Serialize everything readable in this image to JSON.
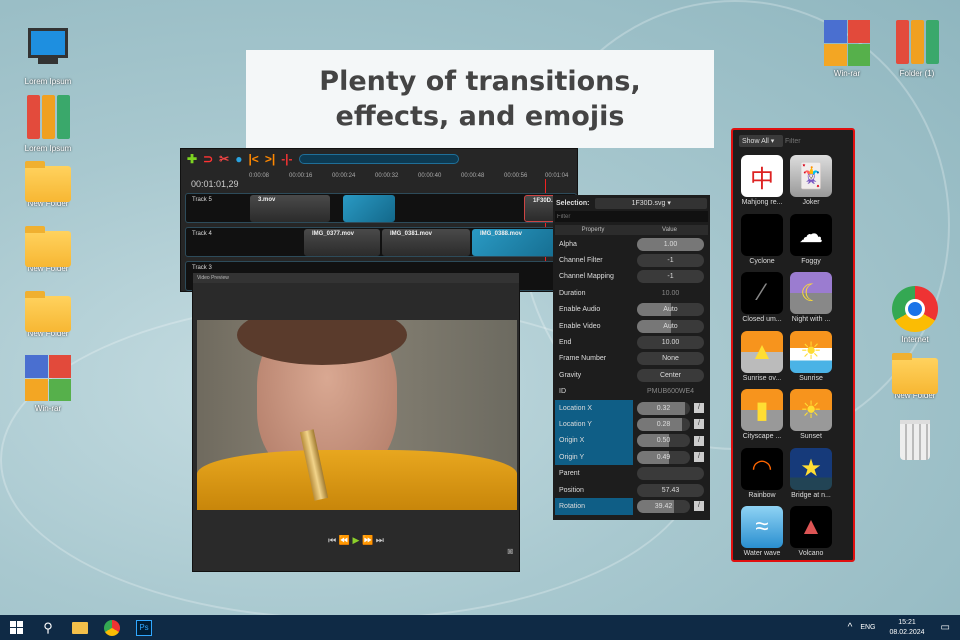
{
  "banner": {
    "line1": "Plenty of transitions,",
    "line2": "effects, and emojis"
  },
  "desktop_left": [
    {
      "label": "Lorem Ipsum",
      "icon": "computer-icon"
    },
    {
      "label": "Lorem Ipsum",
      "icon": "binders-icon"
    },
    {
      "label": "New Folder",
      "icon": "folder-icon"
    },
    {
      "label": "New Folder",
      "icon": "folder-icon"
    },
    {
      "label": "New Folder",
      "icon": "folder-icon"
    },
    {
      "label": "Win-rar",
      "icon": "winrar-icon"
    }
  ],
  "desktop_top_right": [
    {
      "label": "Win-rar",
      "icon": "winrar-icon"
    },
    {
      "label": "Folder (1)",
      "icon": "binders-icon"
    }
  ],
  "desktop_right": [
    {
      "label": "Internet",
      "icon": "chrome-icon"
    },
    {
      "label": "New Folder",
      "icon": "folder-icon"
    },
    {
      "label": "",
      "icon": "recycle-bin-icon"
    }
  ],
  "timeline": {
    "timecode": "00:01:01,29",
    "ticks": [
      "0:00:08",
      "00:00:16",
      "00:00:24",
      "00:00:32",
      "00:00:40",
      "00:00:48",
      "00:00:56",
      "00:01:04"
    ],
    "tracks": [
      {
        "name": "Track 5",
        "clips": [
          "3.mov",
          "1F30D.svg"
        ]
      },
      {
        "name": "Track 4",
        "clips": [
          "IMG_0377.mov",
          "IMG_0381.mov",
          "IMG_0388.mov"
        ]
      },
      {
        "name": "Track 3",
        "clips": []
      }
    ]
  },
  "preview": {
    "title": "Video Preview"
  },
  "properties": {
    "selection_label": "Selection:",
    "selection_value": "1F30D.svg",
    "filter_placeholder": "Filter",
    "col_property": "Property",
    "col_value": "Value",
    "rows": [
      {
        "name": "Alpha",
        "value": "1.00",
        "fill": 1,
        "selected": false
      },
      {
        "name": "Channel Filter",
        "value": "-1",
        "fill": 0,
        "selected": false
      },
      {
        "name": "Channel Mapping",
        "value": "-1",
        "fill": 0,
        "selected": false
      },
      {
        "name": "Duration",
        "value": "10.00",
        "fill": null,
        "selected": false
      },
      {
        "name": "Enable Audio",
        "value": "Auto",
        "fill": 0.5,
        "selected": false
      },
      {
        "name": "Enable Video",
        "value": "Auto",
        "fill": 0.5,
        "selected": false
      },
      {
        "name": "End",
        "value": "10.00",
        "fill": 0,
        "selected": false
      },
      {
        "name": "Frame Number",
        "value": "None",
        "fill": 0,
        "selected": false
      },
      {
        "name": "Gravity",
        "value": "Center",
        "fill": 0,
        "selected": false
      },
      {
        "name": "ID",
        "value": "PMUB600WE4",
        "fill": null,
        "selected": false
      },
      {
        "name": "Location X",
        "value": "0.32",
        "fill": 0.9,
        "selected": true
      },
      {
        "name": "Location Y",
        "value": "0.28",
        "fill": 0.85,
        "selected": true
      },
      {
        "name": "Origin X",
        "value": "0.50",
        "fill": 0.6,
        "selected": true
      },
      {
        "name": "Origin Y",
        "value": "0.49",
        "fill": 0.6,
        "selected": true
      },
      {
        "name": "Parent",
        "value": "",
        "fill": 0,
        "selected": false
      },
      {
        "name": "Position",
        "value": "57.43",
        "fill": 0,
        "selected": false
      },
      {
        "name": "Rotation",
        "value": "39.42",
        "fill": 0.7,
        "selected": true
      }
    ]
  },
  "emoji_panel": {
    "show_all": "Show All",
    "filter_placeholder": "Filter",
    "items": [
      {
        "label": "Mahjong re...",
        "glyph": "中"
      },
      {
        "label": "Joker",
        "glyph": "🃏"
      },
      {
        "label": "Cyclone",
        "glyph": ""
      },
      {
        "label": "Foggy",
        "glyph": "☁"
      },
      {
        "label": "Closed um...",
        "glyph": "⁄"
      },
      {
        "label": "Night with ...",
        "glyph": "☾"
      },
      {
        "label": "Sunrise ov...",
        "glyph": "▲"
      },
      {
        "label": "Sunrise",
        "glyph": "☀"
      },
      {
        "label": "Cityscape ...",
        "glyph": "▮"
      },
      {
        "label": "Sunset",
        "glyph": "☀"
      },
      {
        "label": "Rainbow",
        "glyph": "◠"
      },
      {
        "label": "Bridge at n...",
        "glyph": "★"
      },
      {
        "label": "Water wave",
        "glyph": "≈"
      },
      {
        "label": "Volcano",
        "glyph": "▲"
      }
    ]
  },
  "taskbar": {
    "lang": "ENG",
    "time": "15:21",
    "date": "08.02.2024"
  }
}
